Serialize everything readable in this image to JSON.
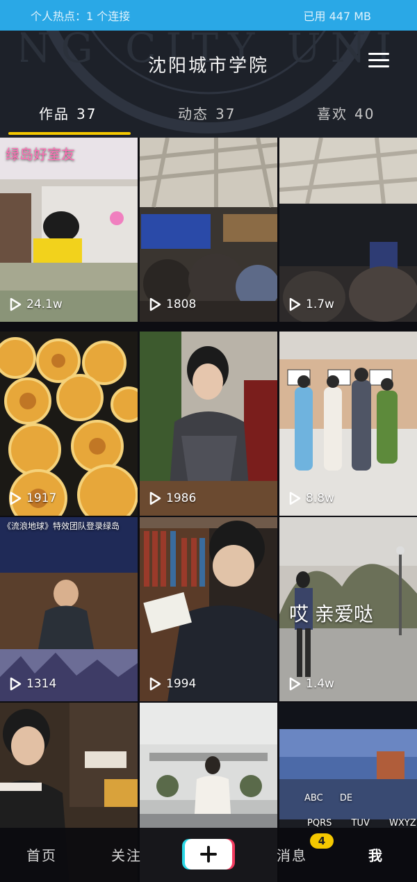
{
  "status_bar": {
    "hotspot": "个人热点：1 个连接",
    "data_used": "已用 447 MB"
  },
  "header": {
    "title": "沈阳城市学院",
    "watermark_text": "NG CITY UNI",
    "menu_icon": "hamburger-menu-icon"
  },
  "tabs": [
    {
      "label": "作品",
      "count": "37"
    },
    {
      "label": "动态",
      "count": "37"
    },
    {
      "label": "喜欢",
      "count": "40"
    }
  ],
  "videos": [
    {
      "views": "24.1w",
      "caption": "绿岛好室友"
    },
    {
      "views": "1808",
      "caption": ""
    },
    {
      "views": "1.7w",
      "caption": ""
    },
    {
      "views": "1917",
      "caption": ""
    },
    {
      "views": "1986",
      "caption": ""
    },
    {
      "views": "8.8w",
      "caption": ""
    },
    {
      "views": "1314",
      "caption": "《流浪地球》特效团队登录绿岛"
    },
    {
      "views": "1994",
      "caption": ""
    },
    {
      "views": "1.4w",
      "caption": "哎 亲爱哒"
    },
    {
      "views": "",
      "caption": ""
    },
    {
      "views": "",
      "caption": ""
    },
    {
      "views": "",
      "caption": "",
      "keyboard": [
        "ABC",
        "DE",
        "PQRS",
        "TUV",
        "WXYZ"
      ]
    }
  ],
  "bottom_nav": {
    "home": "首页",
    "follow": "关注",
    "messages": "消息",
    "messages_badge": "4",
    "me": "我"
  },
  "colors": {
    "status_bar": "#2aa8e6",
    "header_bg": "#1d2129",
    "accent": "#f5c800"
  }
}
